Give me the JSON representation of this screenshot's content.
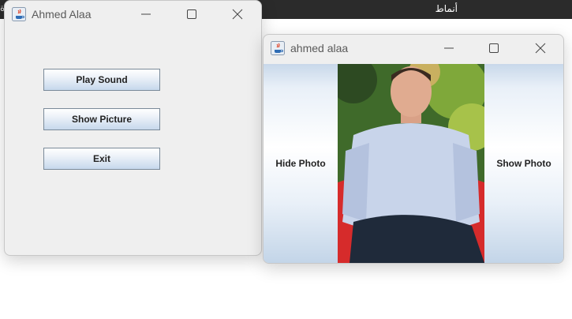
{
  "desktop": {
    "topbar_text": "أنماط",
    "topbar_edge_char": "ة"
  },
  "window_main": {
    "title": "Ahmed Alaa",
    "buttons": {
      "play_sound": "Play Sound",
      "show_picture": "Show Picture",
      "exit": "Exit"
    }
  },
  "window_photo": {
    "title": "ahmed alaa",
    "buttons": {
      "hide_photo": "Hide Photo",
      "show_photo": "Show Photo"
    }
  },
  "icons": [
    "java-icon",
    "minimize-icon",
    "maximize-icon",
    "close-icon"
  ],
  "colors": {
    "topbar": "#2b2b2b",
    "window_bg": "#efefef",
    "button_gradient_bottom": "#c6d8ec"
  }
}
